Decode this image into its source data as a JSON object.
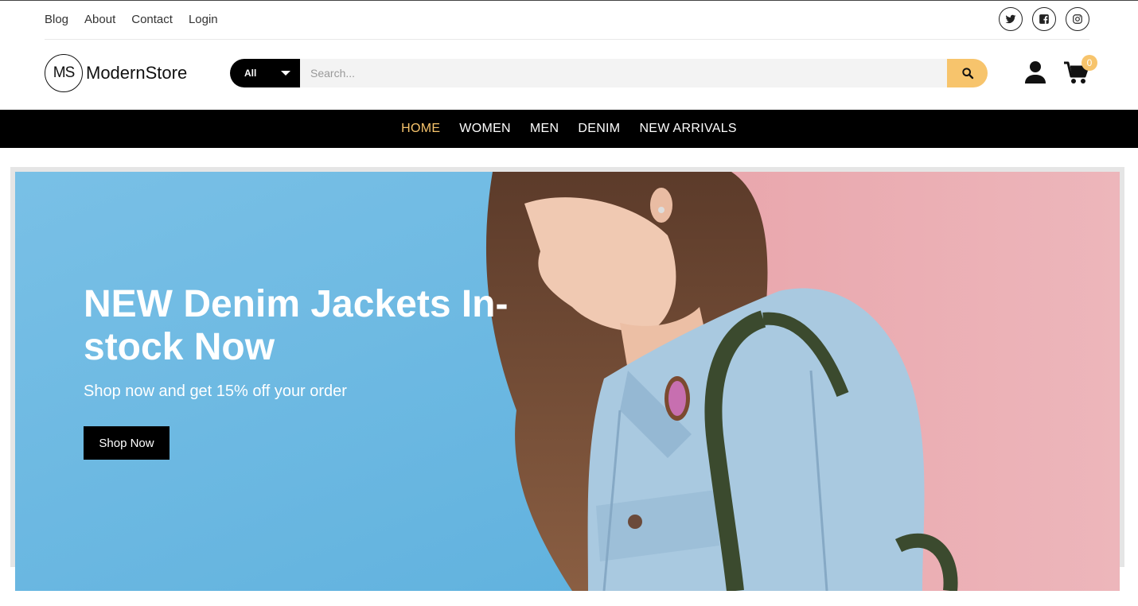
{
  "topbar": {
    "links": [
      {
        "label": "Blog"
      },
      {
        "label": "About"
      },
      {
        "label": "Contact"
      },
      {
        "label": "Login"
      }
    ],
    "social_icons": [
      "twitter-icon",
      "facebook-icon",
      "instagram-icon"
    ]
  },
  "header": {
    "logo_mark": "MS",
    "logo_text": "ModernStore",
    "search": {
      "category": "All",
      "placeholder": "Search...",
      "button_icon": "search-icon"
    },
    "user_icon": "user-icon",
    "cart": {
      "icon": "cart-icon",
      "count": "0"
    }
  },
  "nav": {
    "items": [
      {
        "label": "HOME",
        "active": true
      },
      {
        "label": "WOMEN",
        "active": false
      },
      {
        "label": "MEN",
        "active": false
      },
      {
        "label": "DENIM",
        "active": false
      },
      {
        "label": "NEW ARRIVALS",
        "active": false
      }
    ]
  },
  "hero": {
    "title": "NEW Denim Jackets In-stock Now",
    "subtitle": "Shop now and get 15% off your order",
    "button_label": "Shop Now"
  },
  "colors": {
    "accent": "#f7c46c",
    "nav_bg": "#000000",
    "hero_blue": "#6db8e0",
    "hero_pink": "#e8aab0",
    "denim": "#a9c9e0"
  }
}
